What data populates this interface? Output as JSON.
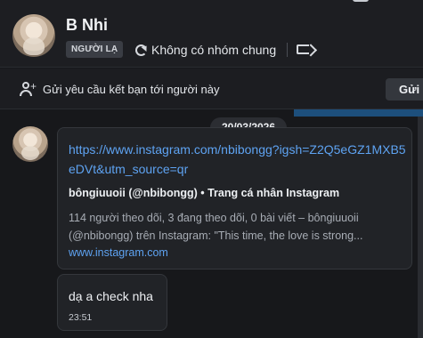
{
  "header": {
    "name": "B Nhi",
    "badge": "NGƯỜI LẠ",
    "groups_label": "Không có nhóm chung"
  },
  "friend_request": {
    "text": "Gửi yêu cầu kết bạn tới người này",
    "button_label": "Gửi"
  },
  "chat": {
    "date": "20/03/2026",
    "messages": [
      {
        "type": "link",
        "url": "https://www.instagram.com/nbibongg?igsh=Z2Q5eGZ1MXB5eDVt&utm_source=qr",
        "preview_title": "bôngiuuoii (@nbibongg) • Trang cá nhân Instagram",
        "preview_description": "114 người theo dõi, 3 đang theo dõi, 0 bài viết – bôngiuuoii (@nbibongg) trên Instagram: \"This time, the love is strong...",
        "domain": "www.instagram.com"
      },
      {
        "type": "text",
        "text": "dạ a check nha",
        "time": "23:51"
      }
    ]
  },
  "icons": {
    "groups": "sync-icon",
    "tag": "tag-icon",
    "add_friend": "add-user-icon"
  },
  "colors": {
    "link": "#5ea3f2",
    "accent_strip": "#1d4f7c"
  }
}
